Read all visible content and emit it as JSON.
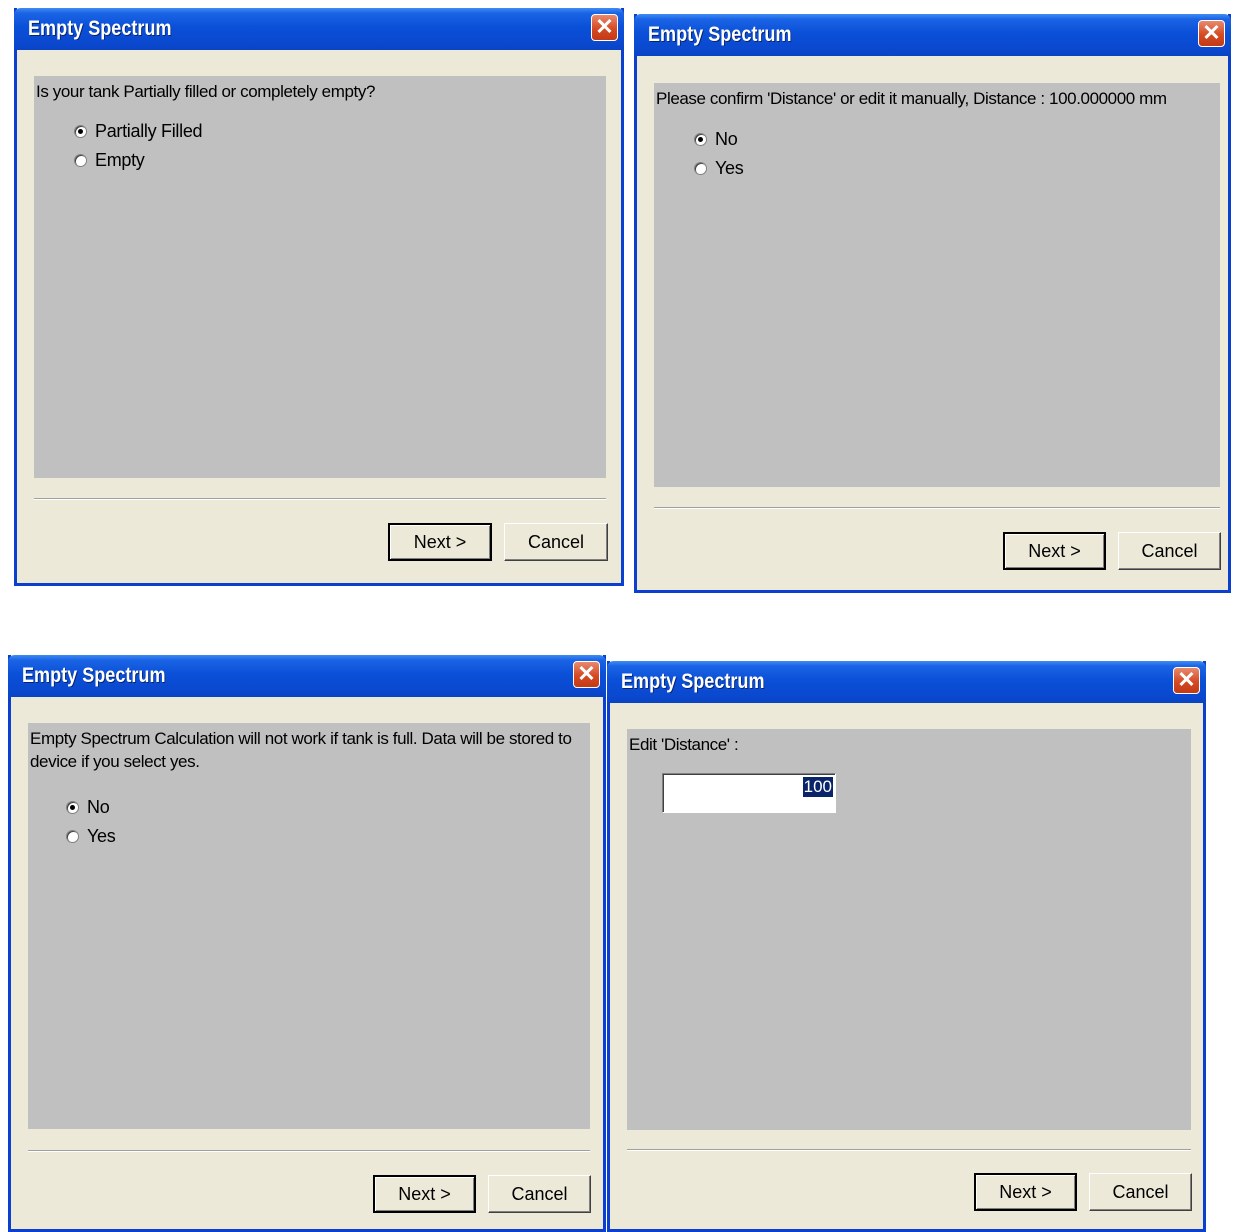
{
  "dialogs": [
    {
      "title": "Empty Spectrum",
      "prompt": "Is your tank Partially filled or completely empty?",
      "options": [
        {
          "label": "Partially Filled",
          "checked": true
        },
        {
          "label": "Empty",
          "checked": false
        }
      ],
      "next_label": "Next >",
      "cancel_label": "Cancel"
    },
    {
      "title": "Empty Spectrum",
      "prompt": "Please confirm 'Distance' or edit it manually, Distance : 100.000000 mm",
      "options": [
        {
          "label": "No",
          "checked": true
        },
        {
          "label": "Yes",
          "checked": false
        }
      ],
      "next_label": "Next >",
      "cancel_label": "Cancel"
    },
    {
      "title": "Empty Spectrum",
      "prompt": "Empty Spectrum Calculation will not work if tank is full. Data will be stored to device if you select yes.",
      "options": [
        {
          "label": "No",
          "checked": true
        },
        {
          "label": "Yes",
          "checked": false
        }
      ],
      "next_label": "Next >",
      "cancel_label": "Cancel"
    },
    {
      "title": "Empty Spectrum",
      "prompt": "Edit 'Distance' :",
      "input_value": "100",
      "next_label": "Next >",
      "cancel_label": "Cancel"
    }
  ],
  "close_glyph": "✕",
  "colors": {
    "titlebar": "#0a50d8",
    "dialog_bg": "#ece9d8",
    "panel_bg": "#c0c0c0",
    "close_button": "#d54a23",
    "selection": "#0a246a"
  }
}
